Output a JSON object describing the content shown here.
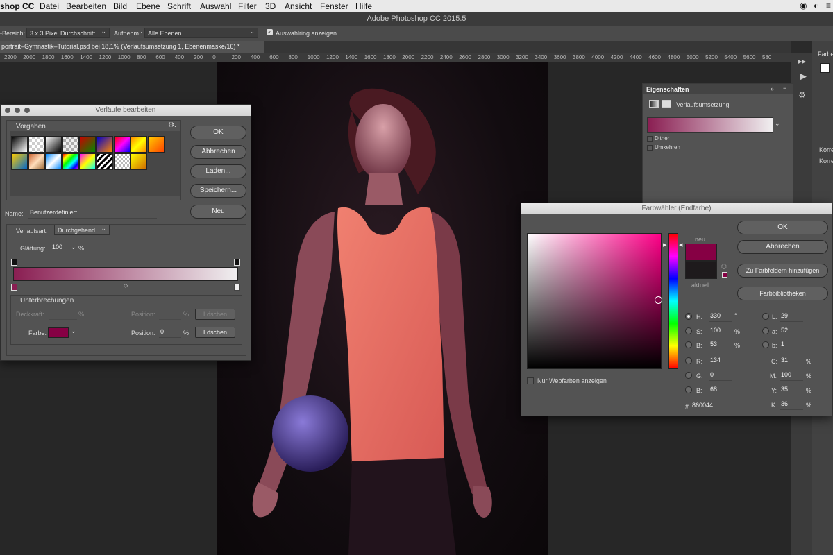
{
  "menubar": {
    "items": [
      "shop CC",
      "Datei",
      "Bearbeiten",
      "Bild",
      "Ebene",
      "Schrift",
      "Auswahl",
      "Filter",
      "3D",
      "Ansicht",
      "Fenster",
      "Hilfe"
    ]
  },
  "window_title": "Adobe Photoshop CC 2015.5",
  "options": {
    "bereich_label": "-Bereich:",
    "bereich_value": "3 x 3 Pixel Durchschnitt",
    "aufnehm_label": "Aufnehm.:",
    "aufnehm_value": "Alle Ebenen",
    "ring_label": "Auswahlring anzeigen"
  },
  "doc_tab": "portrait–Gymnastik–Tutorial.psd bei 18,1% (Verlaufsumsetzung 1, Ebenenmaske/16) *",
  "ruler_labels": [
    "2200",
    "2000",
    "1800",
    "1600",
    "1400",
    "1200",
    "1000",
    "800",
    "600",
    "400",
    "200",
    "0",
    "200",
    "400",
    "600",
    "800",
    "1000",
    "1200",
    "1400",
    "1600",
    "1800",
    "2000",
    "2200",
    "2400",
    "2600",
    "2800",
    "3000",
    "3200",
    "3400",
    "3600",
    "3800",
    "4000",
    "4200",
    "4400",
    "4600",
    "4800",
    "5000",
    "5200",
    "5400",
    "5600",
    "580"
  ],
  "properties": {
    "tab": "Eigenschaften",
    "title": "Verlaufsumsetzung",
    "dither": "Dither",
    "umkehren": "Umkehren"
  },
  "right_panel": {
    "farbe": "Farbe",
    "korr1": "Korre",
    "korr2": "Korre"
  },
  "gradient_dialog": {
    "title": "Verläufe bearbeiten",
    "vorgaben": "Vorgaben",
    "ok": "OK",
    "abbrechen": "Abbrechen",
    "laden": "Laden...",
    "speichern": "Speichern...",
    "name_label": "Name:",
    "name_value": "Benutzerdefiniert",
    "neu": "Neu",
    "verlaufsart_label": "Verlaufsart:",
    "verlaufsart_value": "Durchgehend",
    "glaettung_label": "Glättung:",
    "glaettung_value": "100",
    "percent": "%",
    "unterbrechungen": "Unterbrechungen",
    "deckkraft_label": "Deckkraft:",
    "position_label": "Position:",
    "loeschen": "Löschen",
    "farbe_label": "Farbe:",
    "position_value": "0"
  },
  "picker": {
    "title": "Farbwähler (Endfarbe)",
    "neu": "neu",
    "aktuell": "aktuell",
    "ok": "OK",
    "abbrechen": "Abbrechen",
    "zu_farbfeldern": "Zu Farbfeldern hinzufügen",
    "farbbibliotheken": "Farbbibliotheken",
    "webfarben": "Nur Webfarben anzeigen",
    "h_label": "H:",
    "h_value": "330",
    "h_unit": "°",
    "s_label": "S:",
    "s_value": "100",
    "s_unit": "%",
    "b_label": "B:",
    "b_value": "53",
    "b_unit": "%",
    "r_label": "R:",
    "r_value": "134",
    "g_label": "G:",
    "g_value": "0",
    "b2_label": "B:",
    "b2_value": "68",
    "l_label": "L:",
    "l_value": "29",
    "a_label": "a:",
    "a_value": "52",
    "bb_label": "b:",
    "bb_value": "1",
    "c_label": "C:",
    "c_value": "31",
    "c_unit": "%",
    "m_label": "M:",
    "m_value": "100",
    "m_unit": "%",
    "y_label": "Y:",
    "y_value": "35",
    "y_unit": "%",
    "k_label": "K:",
    "k_value": "36",
    "k_unit": "%",
    "hex_label": "#",
    "hex_value": "860044"
  },
  "colors": {
    "new_color": "#860044",
    "current_color": "#1e1a1c",
    "gradient_start": "#8a1e52",
    "gradient_end": "#f0eff0"
  }
}
